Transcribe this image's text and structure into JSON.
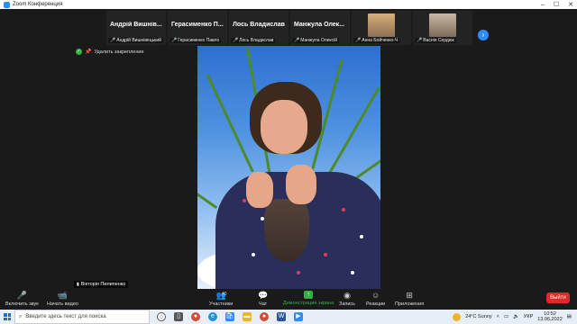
{
  "window": {
    "title": "Zoom Конференция"
  },
  "gallery": {
    "tiles": [
      {
        "big": "Андрій Вишнів...",
        "small": "Андрій Вишнівецький"
      },
      {
        "big": "Герасименко П...",
        "small": "Герасименко Павло"
      },
      {
        "big": "Лось Владислав",
        "small": "Лось Владислав"
      },
      {
        "big": "Манжула Олек...",
        "small": "Манжула Олексій"
      },
      {
        "big": "",
        "small": "Анна Бойченко-Ч"
      },
      {
        "big": "",
        "small": "Васнія Сердюк"
      }
    ]
  },
  "unpin": {
    "label": "Удалить закрепление"
  },
  "pinned": {
    "name": "Вікторія Пилипенко"
  },
  "controls": {
    "audio": "Включить звук",
    "video": "Начать видео",
    "participants": "Участники",
    "participants_count": "40",
    "chat": "Чат",
    "share": "Демонстрация экрана",
    "record": "Запись",
    "reactions": "Реакции",
    "apps": "Приложения",
    "leave": "Выйти"
  },
  "taskbar": {
    "search_placeholder": "Введите здесь текст для поиска",
    "weather": "24°C Sunny",
    "lang": "УКР",
    "time": "10:52",
    "date": "13.06.2022"
  },
  "colors": {
    "accent": "#2d8cff",
    "leave": "#e02828",
    "share": "#2fb344"
  }
}
